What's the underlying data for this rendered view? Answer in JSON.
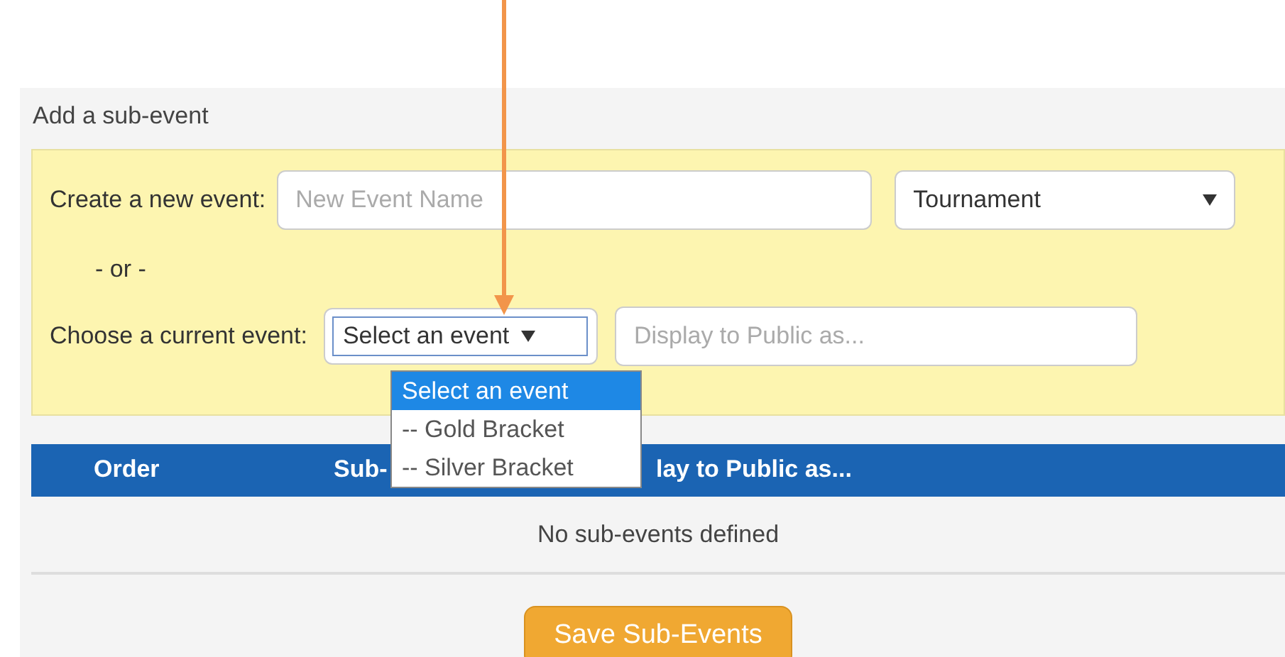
{
  "panel": {
    "title": "Add a sub-event"
  },
  "create_row": {
    "label": "Create a new event:",
    "name_field": {
      "placeholder": "New Event Name"
    },
    "type_select": {
      "value": "Tournament"
    }
  },
  "separator": "- or -",
  "choose_row": {
    "label": "Choose a current event:",
    "event_select": {
      "value": "Select an event",
      "expanded": true,
      "options": [
        {
          "label": "Select an event",
          "selected": true
        },
        {
          "label": "-- Gold Bracket",
          "selected": false
        },
        {
          "label": "-- Silver Bracket",
          "selected": false
        }
      ]
    },
    "public_field": {
      "placeholder": "Display to Public as..."
    }
  },
  "table": {
    "columns": [
      "Order",
      "Sub-",
      "lay to Public as..."
    ],
    "empty_message": "No sub-events defined"
  },
  "save_button": "Save Sub-Events"
}
